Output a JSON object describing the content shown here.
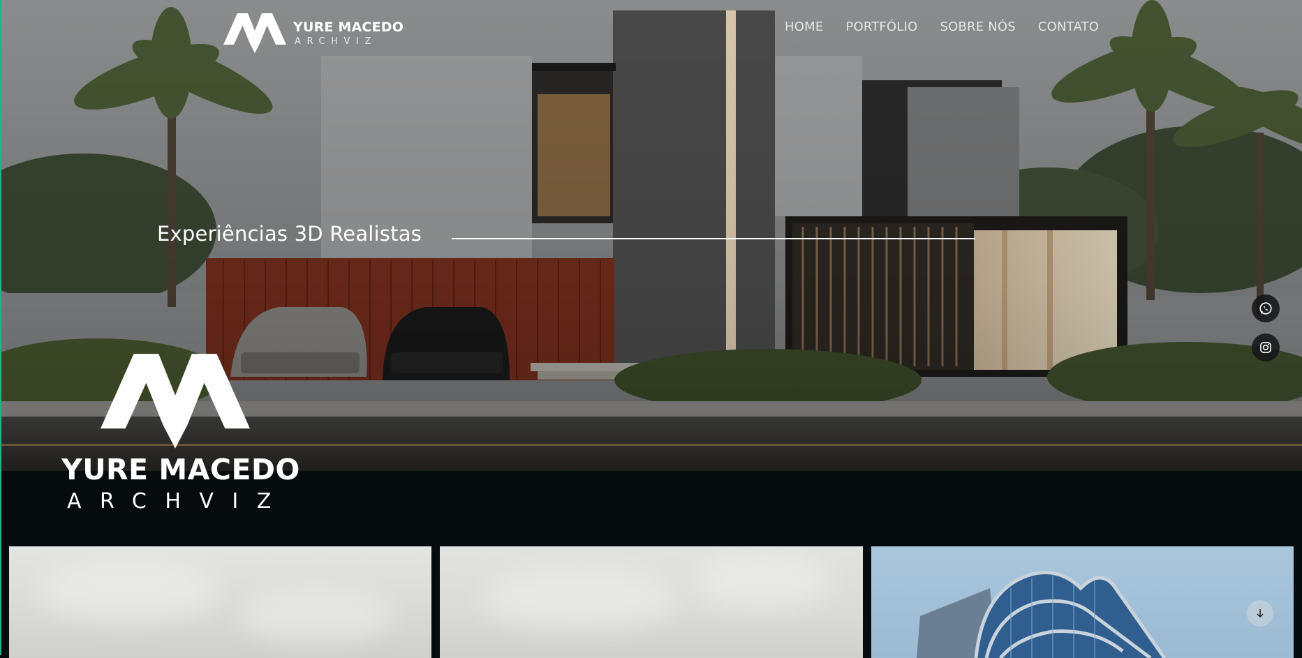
{
  "brand": {
    "name": "YURE MACEDO",
    "subtitle": "ARCHVIZ"
  },
  "nav": {
    "items": [
      {
        "label": "HOME"
      },
      {
        "label": "PORTFÓLIO"
      },
      {
        "label": "SOBRE NÓS"
      },
      {
        "label": "CONTATO"
      }
    ]
  },
  "hero": {
    "tagline": "Experiências 3D Realistas"
  },
  "social": {
    "icons": [
      "whatsapp-icon",
      "instagram-icon"
    ]
  },
  "gallery": {
    "cards": [
      "project-1",
      "project-2",
      "project-3"
    ]
  },
  "icons": {
    "scroll": "arrow-down-icon"
  },
  "colors": {
    "background": "#060b0d",
    "accent": "#21b48a",
    "text": "#ffffff"
  }
}
